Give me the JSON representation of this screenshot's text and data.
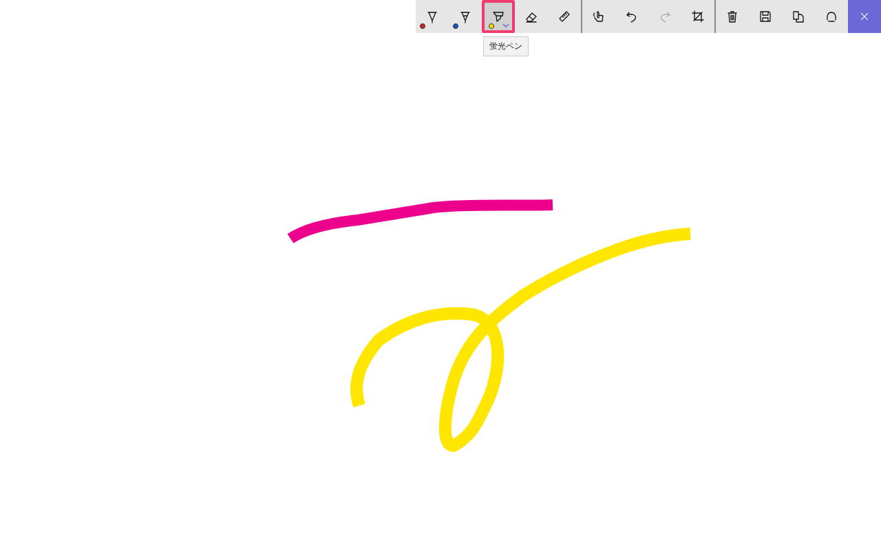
{
  "toolbar": {
    "groups": [
      [
        {
          "kind": "pen",
          "color": "#cc2222",
          "selected": false,
          "disabled": false
        },
        {
          "kind": "pencil",
          "color": "#1155cc",
          "selected": false,
          "disabled": false
        },
        {
          "kind": "highlighter",
          "color": "#f5e000",
          "selected": true,
          "disabled": false
        },
        {
          "kind": "eraser",
          "selected": false,
          "disabled": false
        },
        {
          "kind": "ruler",
          "selected": false,
          "disabled": false
        }
      ],
      [
        {
          "kind": "touch",
          "selected": false,
          "disabled": false
        },
        {
          "kind": "undo",
          "selected": false,
          "disabled": false
        },
        {
          "kind": "redo",
          "selected": false,
          "disabled": true
        },
        {
          "kind": "crop",
          "selected": false,
          "disabled": false
        }
      ],
      [
        {
          "kind": "delete",
          "selected": false,
          "disabled": false
        },
        {
          "kind": "save",
          "selected": false,
          "disabled": false
        },
        {
          "kind": "copy",
          "selected": false,
          "disabled": false
        },
        {
          "kind": "share",
          "selected": false,
          "disabled": false
        }
      ]
    ],
    "close": {
      "kind": "close"
    }
  },
  "tooltip": {
    "text": "蛍光ペン"
  },
  "strokes": [
    {
      "kind": "line",
      "color": "#ec008c"
    },
    {
      "kind": "loop",
      "color": "#ffe600"
    }
  ]
}
